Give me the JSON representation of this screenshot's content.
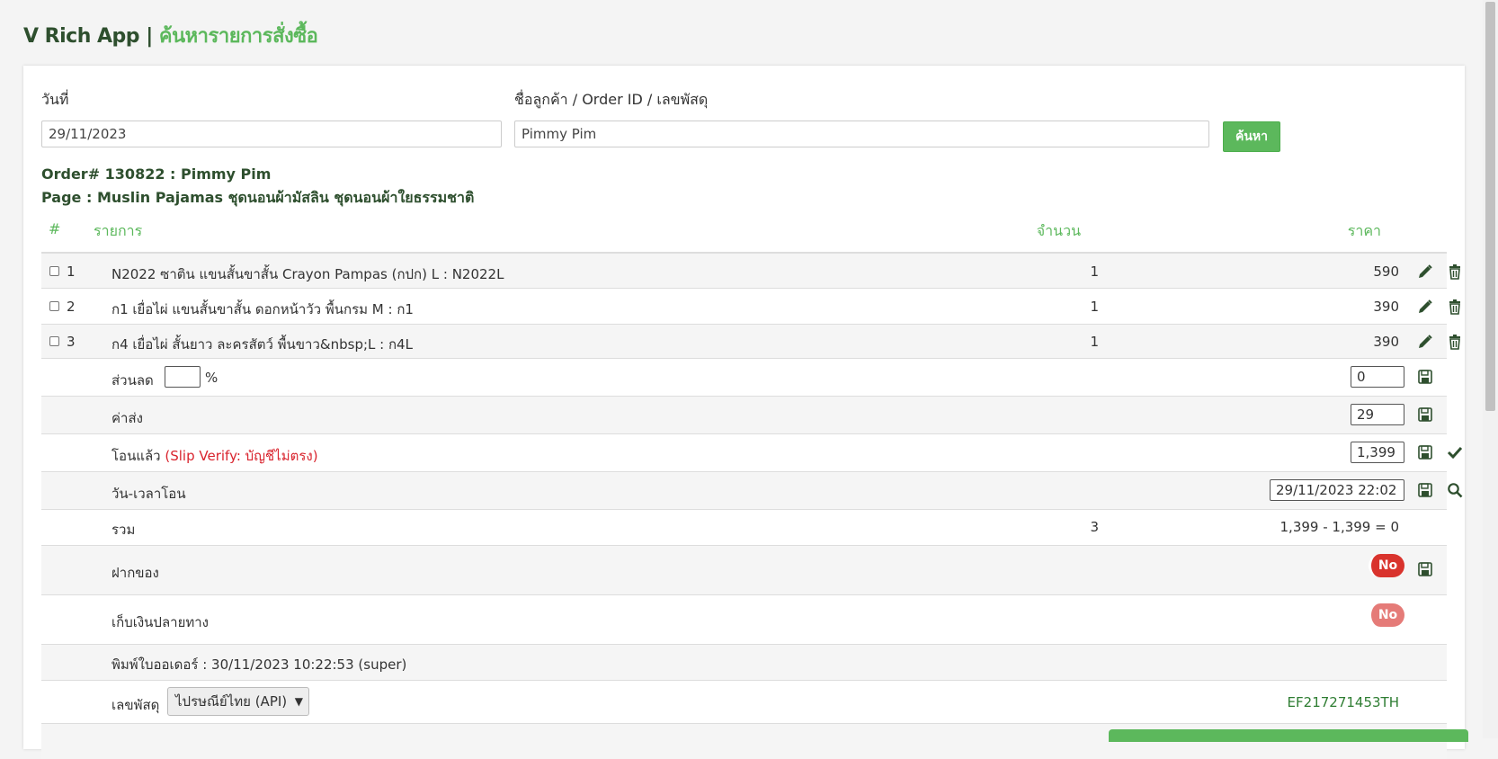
{
  "header": {
    "app_name": "V Rich App |",
    "page_name": "ค้นหารายการสั่งซื้อ"
  },
  "search": {
    "date_label": "วันที่",
    "date_value": "29/11/2023",
    "customer_label": "ชื่อลูกค้า / Order ID / เลขพัสดุ",
    "customer_value": "Pimmy Pim",
    "search_button": "ค้นหา"
  },
  "order": {
    "title": "Order# 130822 : Pimmy Pim",
    "page": "Page : Muslin Pajamas ชุดนอนผ้ามัสลิน ชุดนอนผ้าใยธรรมชาติ"
  },
  "table": {
    "headers": {
      "index": "#",
      "item": "รายการ",
      "qty": "จำนวน",
      "price": "ราคา"
    },
    "items": [
      {
        "index": "1",
        "name": "N2022 ซาติน แขนสั้นขาสั้น Crayon Pampas (กปก) L : N2022L",
        "qty": "1",
        "price": "590"
      },
      {
        "index": "2",
        "name": "ก1 เยื่อไผ่ แขนสั้นขาสั้น ดอกหน้าวัว พื้นกรม M : ก1",
        "qty": "1",
        "price": "390"
      },
      {
        "index": "3",
        "name": "ก4 เยื่อไผ่ สั้นยาว ละครสัตว์ พื้นขาว&nbsp;L : ก4L",
        "qty": "1",
        "price": "390"
      }
    ]
  },
  "discount": {
    "label": "ส่วนลด",
    "percent_value": "",
    "percent_sign": "%",
    "amount": "0"
  },
  "shipping": {
    "label": "ค่าส่ง",
    "amount": "29"
  },
  "transfer": {
    "label": "โอนแล้ว",
    "note": "(Slip Verify: บัญชีไม่ตรง)",
    "amount": "1,399"
  },
  "transfer_time": {
    "label": "วัน-เวลาโอน",
    "value": "29/11/2023 22:02"
  },
  "total": {
    "label": "รวม",
    "qty": "3",
    "formula": "1,399 - 1,399 = 0"
  },
  "deposit": {
    "label": "ฝากของ",
    "toggle": "No"
  },
  "cod": {
    "label": "เก็บเงินปลายทาง",
    "toggle": "No"
  },
  "printed": {
    "text": "พิมพ์ใบออเดอร์ : 30/11/2023 10:22:53 (super)"
  },
  "tracking": {
    "label": "เลขพัสดุ",
    "carrier": "ไปรษณีย์ไทย (API)",
    "number": "EF217271453TH"
  },
  "colors": {
    "brand_green": "#5cb85c",
    "dark_green": "#2e4f2e",
    "alert_red": "#d9232d"
  },
  "icons": [
    "pencil-icon",
    "trash-icon",
    "save-icon",
    "check-icon",
    "search-icon",
    "chevron-down-icon"
  ]
}
